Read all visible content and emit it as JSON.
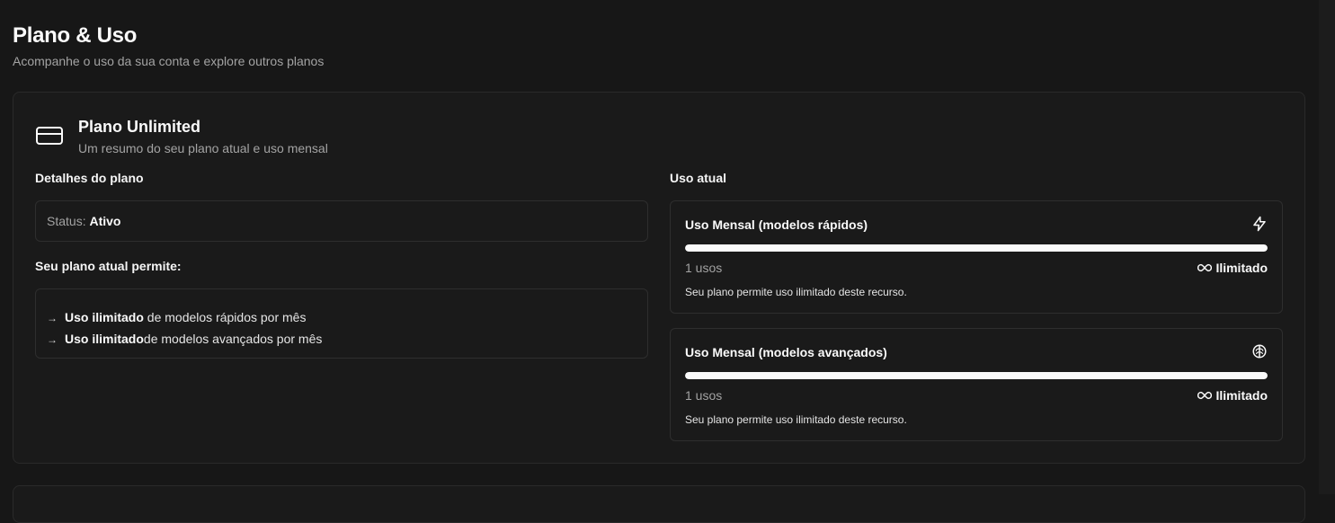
{
  "header": {
    "title": "Plano & Uso",
    "subtitle": "Acompanhe o uso da sua conta e explore outros planos"
  },
  "plan_card": {
    "icon": "credit-card-icon",
    "title": "Plano Unlimited",
    "description": "Um resumo do seu plano atual e uso mensal",
    "details_heading": "Detalhes do plano",
    "status_label": "Status:",
    "status_value": "Ativo",
    "permits_heading": "Seu plano atual permite:",
    "features": [
      {
        "arrow": "→",
        "bold": "Uso ilimitado",
        "rest": " de modelos rápidos por mês"
      },
      {
        "arrow": "→",
        "bold": "Uso ilimitado",
        "rest": "de modelos avançados por mês"
      }
    ],
    "usage_heading": "Uso atual",
    "usage": [
      {
        "title": "Uso Mensal (modelos rápidos)",
        "icon": "lightning-icon",
        "progress_percent": 100,
        "count": "1 usos",
        "limit_icon": "infinity-icon",
        "limit": "Ilimitado",
        "note": "Seu plano permite uso ilimitado deste recurso."
      },
      {
        "title": "Uso Mensal (modelos avançados)",
        "icon": "brain-icon",
        "progress_percent": 100,
        "count": "1 usos",
        "limit_icon": "infinity-icon",
        "limit": "Ilimitado",
        "note": "Seu plano permite uso ilimitado deste recurso."
      }
    ]
  },
  "colors": {
    "background": "#171717",
    "card": "#1a1a1a",
    "border": "#2e2e2e",
    "text": "#fafafa",
    "muted": "#a3a3a3",
    "progress_fill": "#fafafa"
  }
}
